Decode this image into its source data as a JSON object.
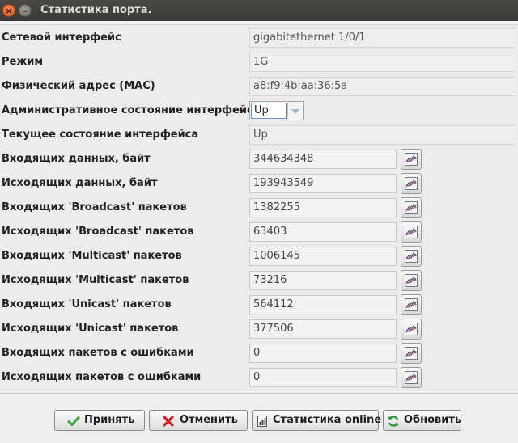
{
  "window": {
    "title": "Статистика порта.",
    "close_glyph": "×",
    "minimize_glyph": "–"
  },
  "fields": {
    "interface": {
      "label": "Сетевой интерфейс",
      "value": "gigabitethernet 1/0/1"
    },
    "mode": {
      "label": "Режим",
      "value": "1G"
    },
    "mac": {
      "label": "Физический адрес (MAC)",
      "value": "a8:f9:4b:aa:36:5a"
    },
    "admin_state": {
      "label": "Административное состояние интерфейса",
      "value": "Up"
    },
    "oper_state": {
      "label": "Текущее состояние интерфейса",
      "value": "Up"
    }
  },
  "counters": [
    {
      "label": "Входящих данных, байт",
      "value": "344634348",
      "icon": "chart-icon"
    },
    {
      "label": "Исходящих данных, байт",
      "value": "193943549",
      "icon": "chart-icon"
    },
    {
      "label": "Входящих 'Broadcast' пакетов",
      "value": "1382255",
      "icon": "chart-icon"
    },
    {
      "label": "Исходящих 'Broadcast' пакетов",
      "value": "63403",
      "icon": "chart-icon"
    },
    {
      "label": "Входящих 'Multicast' пакетов",
      "value": "1006145",
      "icon": "chart-icon"
    },
    {
      "label": "Исходящих 'Multicast' пакетов",
      "value": "73216",
      "icon": "chart-icon"
    },
    {
      "label": "Входящих 'Unicast' пакетов",
      "value": "564112",
      "icon": "chart-icon"
    },
    {
      "label": "Исходящих 'Unicast' пакетов",
      "value": "377506",
      "icon": "chart-icon"
    },
    {
      "label": "Входящих пакетов с ошибками",
      "value": "0",
      "icon": "chart-icon"
    },
    {
      "label": "Исходящих пакетов с ошибками",
      "value": "0",
      "icon": "chart-icon"
    }
  ],
  "buttons": {
    "accept": {
      "label": "Принять",
      "icon": "check-icon",
      "color": "#3aa53a"
    },
    "cancel": {
      "label": "Отменить",
      "icon": "x-icon",
      "color": "#d42020"
    },
    "online": {
      "label": "Статистика online",
      "icon": "report-icon"
    },
    "refresh": {
      "label": "Обновить",
      "icon": "refresh-icon",
      "color": "#2e9a3a"
    }
  }
}
